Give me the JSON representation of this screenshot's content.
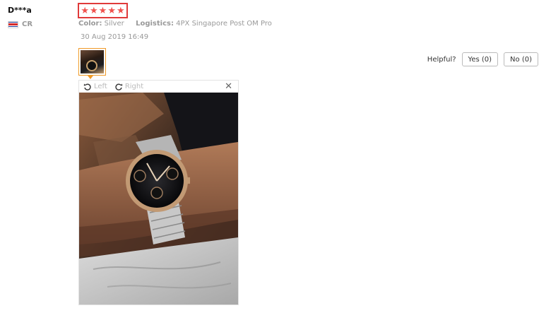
{
  "review": {
    "user_name": "D***a",
    "country_code": "CR",
    "rating": 5,
    "stars": [
      "★",
      "★",
      "★",
      "★",
      "★"
    ],
    "color_label": "Color:",
    "color_value": "Silver",
    "logistics_label": "Logistics:",
    "logistics_value": "4PX Singapore Post OM Pro",
    "date": "30 Aug 2019 16:49"
  },
  "helpful": {
    "label": "Helpful?",
    "yes_label": "Yes (0)",
    "no_label": "No (0)"
  },
  "viewer": {
    "rotate_left_label": "Left",
    "rotate_right_label": "Right",
    "close_glyph": "✕"
  },
  "colors": {
    "star": "#f0524e",
    "star_highlight_border": "#e03a3a",
    "thumb_border": "#f09a28"
  },
  "icons": [
    "costa-rica-flag-icon",
    "star-icon",
    "rotate-left-icon",
    "rotate-right-icon",
    "close-icon"
  ]
}
